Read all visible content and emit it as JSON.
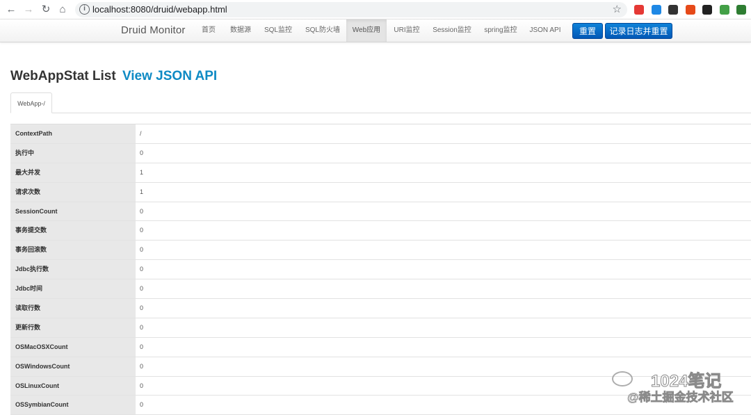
{
  "browser": {
    "url": "localhost:8080/druid/webapp.html",
    "extensions": [
      {
        "name": "ext-1",
        "color": "#e53935"
      },
      {
        "name": "ext-2",
        "color": "#1e88e5"
      },
      {
        "name": "ext-3",
        "color": "#333333"
      },
      {
        "name": "ext-4",
        "color": "#e64a19"
      },
      {
        "name": "ext-5",
        "color": "#222222"
      },
      {
        "name": "ext-6",
        "color": "#43a047"
      },
      {
        "name": "ext-7",
        "color": "#2e7d32"
      }
    ]
  },
  "navbar": {
    "brand": "Druid Monitor",
    "links": [
      "首页",
      "数据源",
      "SQL监控",
      "SQL防火墙",
      "Web应用",
      "URI监控",
      "Session监控",
      "spring监控",
      "JSON API"
    ],
    "active_index": 4,
    "reset_button": "重置",
    "log_reset_button": "记录日志并重置"
  },
  "page": {
    "title": "WebAppStat List",
    "json_link": "View JSON API",
    "tab": "WebApp-/"
  },
  "stats": [
    {
      "key": "ContextPath",
      "value": "/"
    },
    {
      "key": "执行中",
      "value": "0"
    },
    {
      "key": "最大并发",
      "value": "1"
    },
    {
      "key": "请求次数",
      "value": "1"
    },
    {
      "key": "SessionCount",
      "value": "0"
    },
    {
      "key": "事务提交数",
      "value": "0"
    },
    {
      "key": "事务回滚数",
      "value": "0"
    },
    {
      "key": "Jdbc执行数",
      "value": "0"
    },
    {
      "key": "Jdbc时间",
      "value": "0"
    },
    {
      "key": "读取行数",
      "value": "0"
    },
    {
      "key": "更新行数",
      "value": "0"
    },
    {
      "key": "OSMacOSXCount",
      "value": "0"
    },
    {
      "key": "OSWindowsCount",
      "value": "0"
    },
    {
      "key": "OSLinuxCount",
      "value": "0"
    },
    {
      "key": "OSSymbianCount",
      "value": "0"
    }
  ],
  "watermark": {
    "top": "1024笔记",
    "bottom": "@稀土掘金技术社区"
  }
}
